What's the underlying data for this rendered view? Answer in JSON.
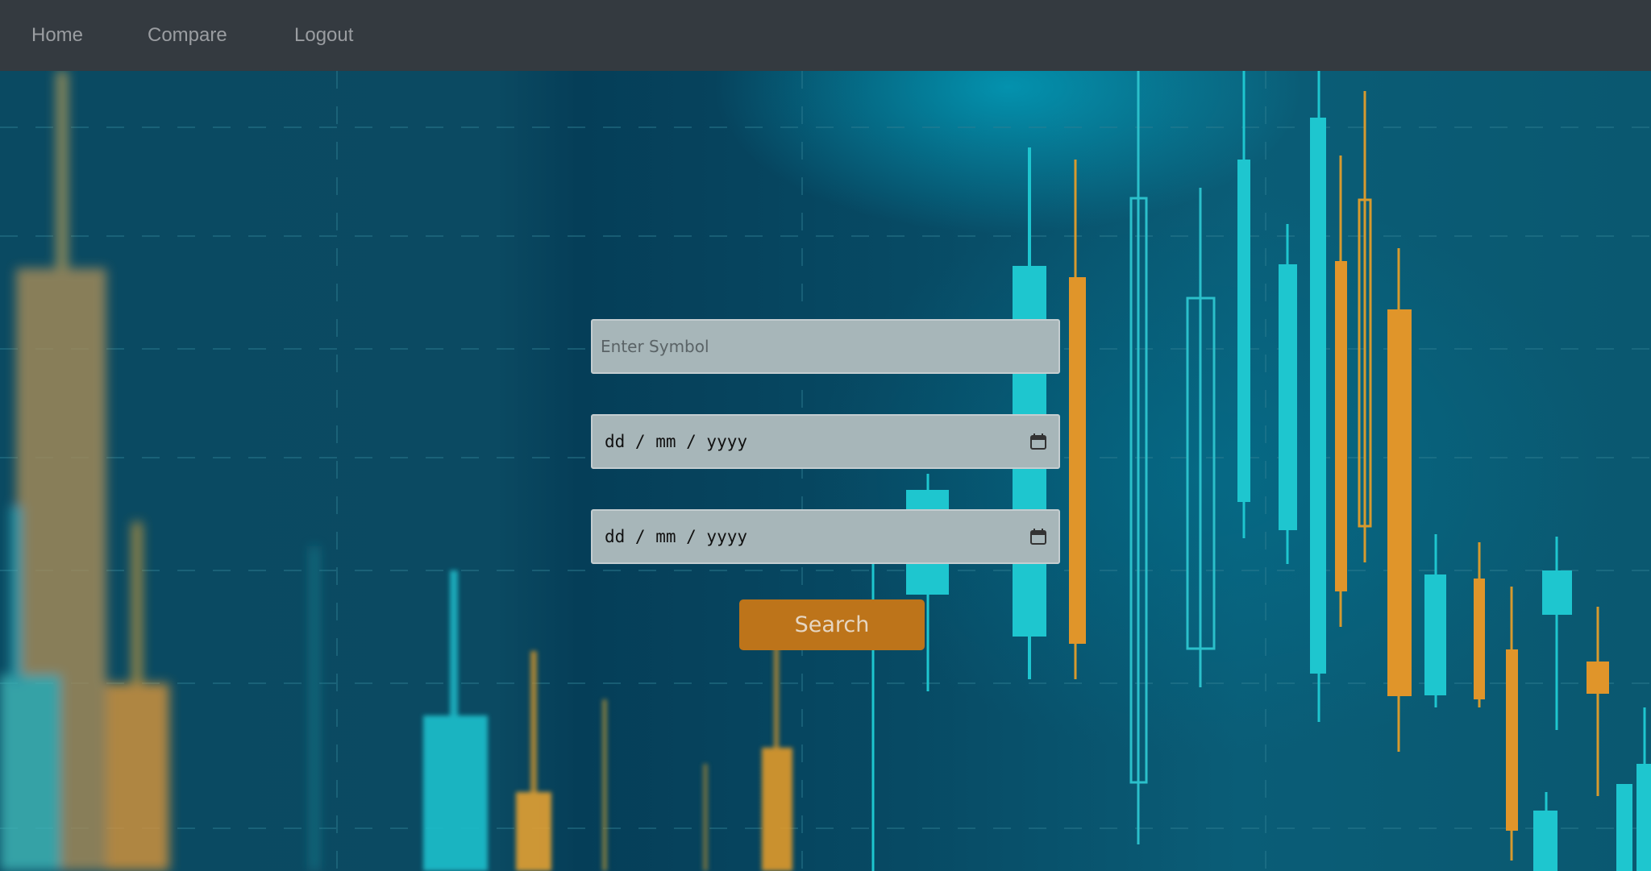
{
  "nav": {
    "home": "Home",
    "compare": "Compare",
    "logout": "Logout"
  },
  "form": {
    "symbol_placeholder": "Enter Symbol",
    "start_date_format": "dd / mm / yyyy",
    "end_date_format": "dd / mm / yyyy",
    "search_label": "Search"
  },
  "icons": {
    "date_picker": "calendar-icon"
  },
  "colors": {
    "navbar": "#343a40",
    "nav_text": "#9a9da1",
    "input_bg": "#a7b6b9",
    "button": "#bd741a",
    "candle_cyan": "#1ec6cf",
    "candle_orange": "#e0952a"
  }
}
